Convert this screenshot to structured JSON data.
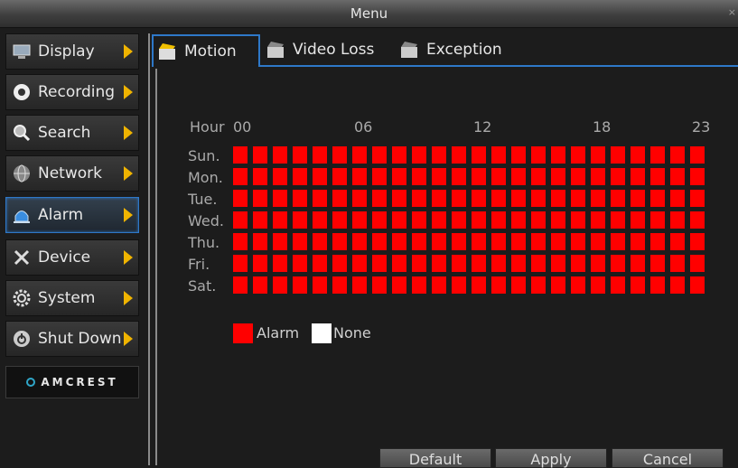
{
  "window": {
    "title": "Menu",
    "close_glyph": "×"
  },
  "sidebar": {
    "items": [
      {
        "label": "Display",
        "icon": "display-icon",
        "active": false
      },
      {
        "label": "Recording",
        "icon": "record-icon",
        "active": false
      },
      {
        "label": "Search",
        "icon": "search-icon",
        "active": false
      },
      {
        "label": "Network",
        "icon": "network-icon",
        "active": false
      },
      {
        "label": "Alarm",
        "icon": "alarm-icon",
        "active": true
      },
      {
        "label": "Device",
        "icon": "tools-icon",
        "active": false
      },
      {
        "label": "System",
        "icon": "gear-icon",
        "active": false
      },
      {
        "label": "Shut Down",
        "icon": "power-icon",
        "active": false
      }
    ],
    "logo_text": "AMCREST"
  },
  "tabs": [
    {
      "label": "Motion",
      "active": true
    },
    {
      "label": "Video Loss",
      "active": false
    },
    {
      "label": "Exception",
      "active": false
    }
  ],
  "schedule": {
    "hour_title": "Hour",
    "hour_marks": [
      "00",
      "06",
      "12",
      "18",
      "23"
    ],
    "days": [
      "Sun.",
      "Mon.",
      "Tue.",
      "Wed.",
      "Thu.",
      "Fri.",
      "Sat."
    ],
    "hours_per_day": 24,
    "all_cells_state": "Alarm"
  },
  "legend": [
    {
      "label": "Alarm",
      "color": "#ff0000"
    },
    {
      "label": "None",
      "color": "#ffffff"
    }
  ],
  "buttons": {
    "default": "Default",
    "apply": "Apply",
    "cancel": "Cancel"
  },
  "colors": {
    "accent": "#2e78c8",
    "alarm": "#ff0000",
    "arrow": "#f0b400"
  }
}
